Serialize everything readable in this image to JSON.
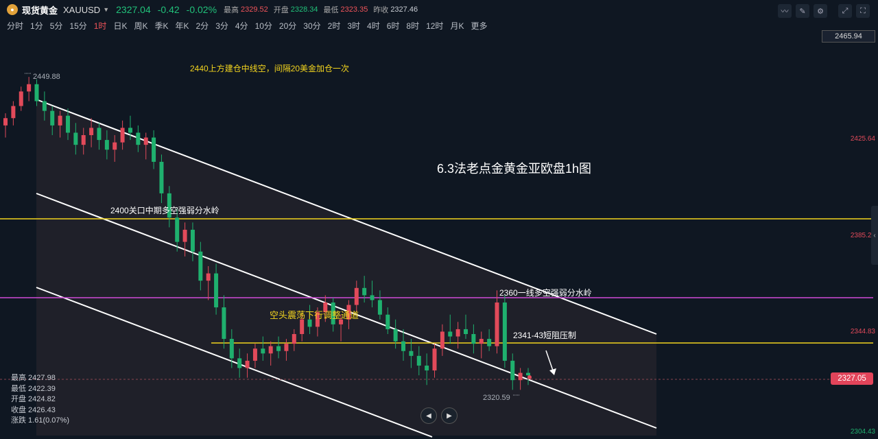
{
  "header": {
    "name": "现货黄金",
    "code": "XAUUSD",
    "price": "2327.04",
    "change": "-0.42",
    "change_pct": "-0.02%",
    "high_label": "最高",
    "high": "2329.52",
    "open_label": "开盘",
    "open": "2328.34",
    "low_label": "最低",
    "low": "2323.35",
    "prev_label": "昨收",
    "prev": "2327.46"
  },
  "timeframes": [
    "分时",
    "1分",
    "5分",
    "15分",
    "1时",
    "日K",
    "周K",
    "季K",
    "年K",
    "2分",
    "3分",
    "4分",
    "10分",
    "20分",
    "30分",
    "2时",
    "3时",
    "4时",
    "6时",
    "8时",
    "12时",
    "月K",
    "更多"
  ],
  "active_timeframe": "1时",
  "chart_data": {
    "type": "candlestick",
    "title": "6.3法老点金黄金亚欧盘1h图",
    "ylim": [
      2300,
      2470
    ],
    "y_ticks": [
      "2465.94",
      "2425.64",
      "2385.23",
      "2344.83",
      "2304.43"
    ],
    "last_price": "2327.05",
    "high_marker": "2449.88",
    "low_marker": "2320.59",
    "annotations": [
      "2440上方建仓中线空，间隔20美金加仓一次",
      "2400关口中期多空强弱分水岭",
      "空头震荡下行调整通道",
      "2360一线多空强弱分水岭",
      "2341-43短阻压制"
    ],
    "horizontal_lines": [
      {
        "price": 2400,
        "color": "#f4d51e"
      },
      {
        "price": 2362,
        "color": "#d04ad8"
      },
      {
        "price": 2342,
        "color": "#f4d51e"
      }
    ],
    "candles": [
      [
        2430,
        2435,
        2425,
        2433
      ],
      [
        2433,
        2440,
        2430,
        2438
      ],
      [
        2438,
        2446,
        2436,
        2444
      ],
      [
        2444,
        2450,
        2440,
        2447
      ],
      [
        2447,
        2449,
        2438,
        2440
      ],
      [
        2440,
        2444,
        2432,
        2436
      ],
      [
        2436,
        2438,
        2426,
        2430
      ],
      [
        2430,
        2436,
        2425,
        2434
      ],
      [
        2434,
        2437,
        2424,
        2427
      ],
      [
        2427,
        2431,
        2418,
        2422
      ],
      [
        2422,
        2429,
        2418,
        2426
      ],
      [
        2426,
        2433,
        2421,
        2429
      ],
      [
        2429,
        2431,
        2420,
        2424
      ],
      [
        2424,
        2428,
        2416,
        2420
      ],
      [
        2420,
        2426,
        2415,
        2423
      ],
      [
        2423,
        2432,
        2420,
        2429
      ],
      [
        2429,
        2434,
        2424,
        2427
      ],
      [
        2427,
        2430,
        2419,
        2422
      ],
      [
        2422,
        2427,
        2416,
        2425
      ],
      [
        2425,
        2428,
        2412,
        2415
      ],
      [
        2415,
        2418,
        2398,
        2402
      ],
      [
        2402,
        2405,
        2388,
        2392
      ],
      [
        2392,
        2396,
        2378,
        2382
      ],
      [
        2382,
        2390,
        2376,
        2387
      ],
      [
        2387,
        2390,
        2374,
        2378
      ],
      [
        2378,
        2382,
        2362,
        2366
      ],
      [
        2366,
        2372,
        2358,
        2369
      ],
      [
        2369,
        2373,
        2352,
        2355
      ],
      [
        2355,
        2360,
        2338,
        2342
      ],
      [
        2342,
        2346,
        2330,
        2334
      ],
      [
        2334,
        2338,
        2326,
        2330
      ],
      [
        2330,
        2336,
        2326,
        2333
      ],
      [
        2333,
        2340,
        2330,
        2338
      ],
      [
        2338,
        2343,
        2333,
        2336
      ],
      [
        2336,
        2341,
        2331,
        2339
      ],
      [
        2339,
        2343,
        2334,
        2337
      ],
      [
        2337,
        2342,
        2333,
        2340
      ],
      [
        2340,
        2346,
        2337,
        2344
      ],
      [
        2344,
        2352,
        2341,
        2350
      ],
      [
        2350,
        2356,
        2344,
        2347
      ],
      [
        2347,
        2355,
        2343,
        2353
      ],
      [
        2353,
        2360,
        2349,
        2357
      ],
      [
        2357,
        2359,
        2345,
        2348
      ],
      [
        2348,
        2352,
        2341,
        2350
      ],
      [
        2350,
        2358,
        2346,
        2356
      ],
      [
        2356,
        2366,
        2353,
        2363
      ],
      [
        2363,
        2368,
        2357,
        2360
      ],
      [
        2360,
        2366,
        2355,
        2358
      ],
      [
        2358,
        2362,
        2350,
        2352
      ],
      [
        2352,
        2355,
        2344,
        2346
      ],
      [
        2346,
        2350,
        2338,
        2341
      ],
      [
        2341,
        2346,
        2333,
        2337
      ],
      [
        2337,
        2342,
        2330,
        2335
      ],
      [
        2335,
        2339,
        2327,
        2331
      ],
      [
        2331,
        2336,
        2323,
        2329
      ],
      [
        2329,
        2340,
        2326,
        2338
      ],
      [
        2338,
        2348,
        2335,
        2345
      ],
      [
        2345,
        2352,
        2340,
        2343
      ],
      [
        2343,
        2349,
        2338,
        2346
      ],
      [
        2346,
        2352,
        2342,
        2344
      ],
      [
        2344,
        2348,
        2336,
        2340
      ],
      [
        2340,
        2345,
        2334,
        2342
      ],
      [
        2342,
        2346,
        2337,
        2339
      ],
      [
        2339,
        2362,
        2336,
        2357
      ],
      [
        2357,
        2360,
        2330,
        2333
      ],
      [
        2333,
        2336,
        2321,
        2325
      ],
      [
        2325,
        2330,
        2321,
        2328
      ],
      [
        2328,
        2330,
        2323,
        2327
      ]
    ]
  }
}
